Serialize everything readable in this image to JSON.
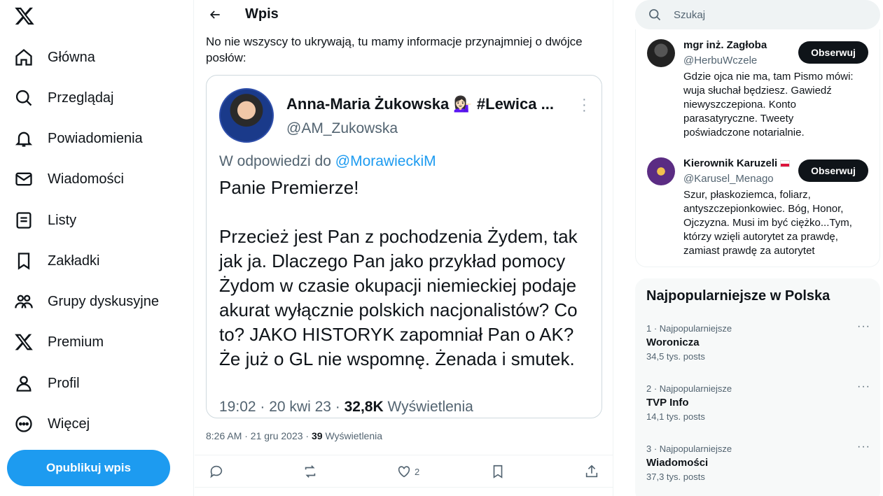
{
  "sidebar": {
    "logo": "x-logo",
    "items": [
      {
        "label": "Główna",
        "icon": "home-icon"
      },
      {
        "label": "Przeglądaj",
        "icon": "search-icon"
      },
      {
        "label": "Powiadomienia",
        "icon": "bell-icon"
      },
      {
        "label": "Wiadomości",
        "icon": "envelope-icon"
      },
      {
        "label": "Listy",
        "icon": "list-icon"
      },
      {
        "label": "Zakładki",
        "icon": "bookmark-icon"
      },
      {
        "label": "Grupy dyskusyjne",
        "icon": "communities-icon"
      },
      {
        "label": "Premium",
        "icon": "x-logo-icon"
      },
      {
        "label": "Profil",
        "icon": "person-icon"
      },
      {
        "label": "Więcej",
        "icon": "more-circle-icon"
      }
    ],
    "publish_label": "Opublikuj wpis"
  },
  "main": {
    "header_title": "Wpis",
    "post_text": "No nie wszyscy to ukrywają, tu mamy informacje przynajmniej o dwójce posłów:",
    "quote": {
      "name": "Anna-Maria Żukowska 💁🏻‍♀️ #Lewica ...",
      "handle": "@AM_Zukowska",
      "reply_prefix": "W odpowiedzi do",
      "reply_to": "@MorawieckiM",
      "body": "Panie Premierze!\n\nPrzecież jest Pan z pochodzenia Żydem, tak jak ja. Dlaczego Pan jako przykład pomocy Żydom w czasie okupacji niemieckiej podaje akurat wyłącznie polskich nacjonalistów? Co to? JAKO HISTORYK zapomniał Pan o AK? Że już o GL nie wspomnę. Żenada i smutek.",
      "meta_time": "19:02 · 20 kwi 23 · ",
      "meta_views": "32,8K",
      "meta_views_label": " Wyświetlenia"
    },
    "post_meta_time": "8:26 AM · 21 gru 2023 · ",
    "post_meta_views": "39",
    "post_meta_views_label": " Wyświetlenia",
    "likes": "2"
  },
  "right": {
    "search_placeholder": "Szukaj",
    "who_to_follow": [
      {
        "name": "mgr inż. Zagłoba",
        "handle": "@HerbuWczele",
        "bio": "Gdzie ojca nie ma, tam Pismo mówi: wuja słuchał będziesz. Gawiedź niewyszczepiona. Konto parasatyryczne. Tweety poświadczone notarialnie.",
        "follow_label": "Obserwuj"
      },
      {
        "name": "Kierownik Karuzeli",
        "handle": "@Karusel_Menago",
        "bio": "Szur, płaskoziemca, foliarz, antyszczepionkowiec. Bóg, Honor, Ojczyzna. Musi im być ciężko...Tym, którzy wzięli autorytet za prawdę, zamiast prawdę za autorytet",
        "follow_label": "Obserwuj"
      }
    ],
    "trends_title": "Najpopularniejsze w Polska",
    "trends": [
      {
        "category": "1 · Najpopularniejsze",
        "name": "Woronicza",
        "count": "34,5 tys. posts"
      },
      {
        "category": "2 · Najpopularniejsze",
        "name": "TVP Info",
        "count": "14,1 tys. posts"
      },
      {
        "category": "3 · Najpopularniejsze",
        "name": "Wiadomości",
        "count": "37,3 tys. posts"
      }
    ]
  },
  "colors": {
    "accent": "#1d9bf0",
    "text": "#0f1419",
    "muted": "#536471"
  }
}
